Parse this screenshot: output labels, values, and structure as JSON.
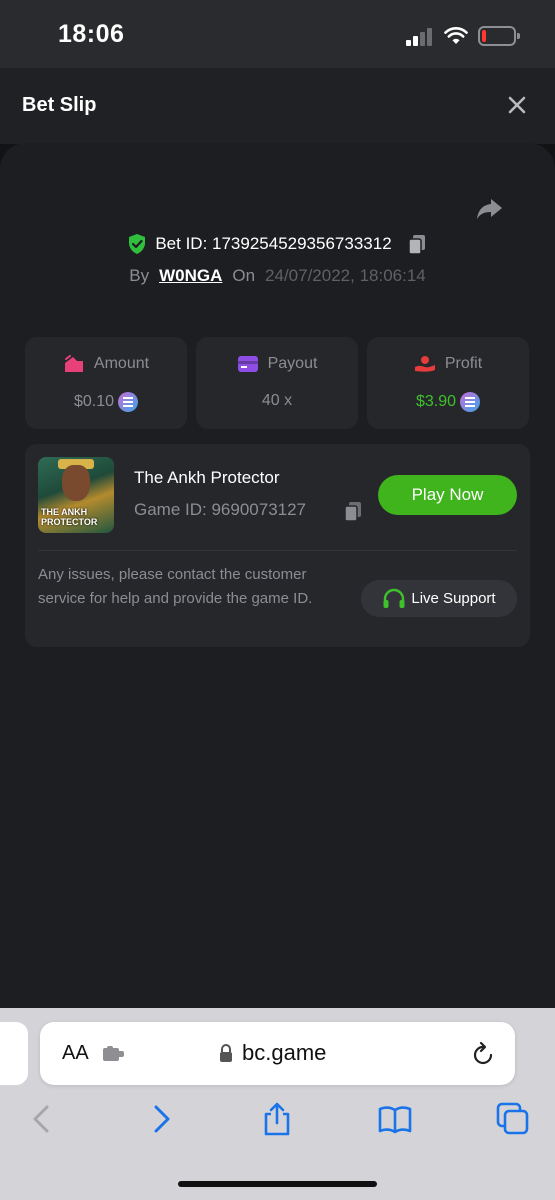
{
  "status_bar": {
    "time": "18:06"
  },
  "header": {
    "title": "Bet Slip"
  },
  "bet": {
    "id_text": "Bet ID: 1739254529356733312",
    "by_label": "By",
    "username": "W0NGA",
    "on_label": "On",
    "datetime": "24/07/2022, 18:06:14"
  },
  "stats": [
    {
      "label": "Amount",
      "value": "$0.10",
      "icon": "wallet-icon",
      "icon_color": "#e8417a"
    },
    {
      "label": "Payout",
      "value": "40 x",
      "icon": "card-icon",
      "icon_color": "#8e4ee6"
    },
    {
      "label": "Profit",
      "value": "$3.90",
      "icon": "profit-icon",
      "icon_color": "#e83c3c"
    }
  ],
  "game": {
    "title": "The Ankh Protector",
    "game_id": "Game ID: 9690073127",
    "thumb_text": "THE ANKH PROTECTOR",
    "play_label": "Play Now",
    "issues_text": "Any issues, please contact the customer service for help and provide the game ID.",
    "support_label": "Live Support"
  },
  "browser": {
    "aa_label": "AA",
    "url": "bc.game"
  },
  "colors": {
    "accent_green": "#3fb41d",
    "profit_green": "#3fc12b",
    "background": "#1d1e21"
  }
}
